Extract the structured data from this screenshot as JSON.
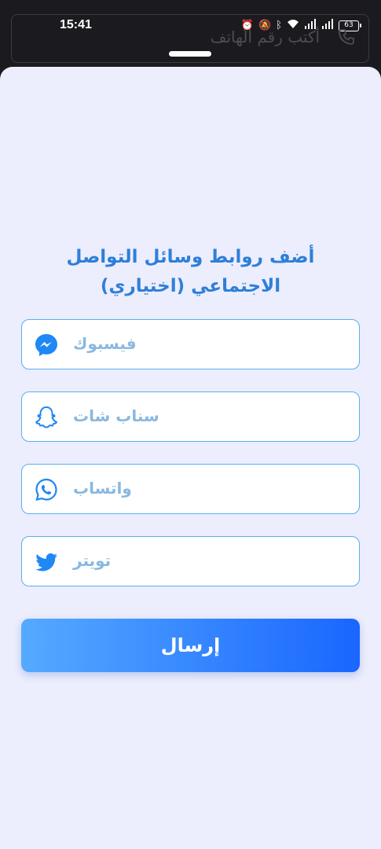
{
  "status_bar": {
    "time": "15:41",
    "battery": "63",
    "icons": [
      "alarm-icon",
      "mute-icon",
      "bluetooth-icon",
      "wifi-icon",
      "signal-icon",
      "signal-icon",
      "battery-icon"
    ]
  },
  "background_field": {
    "placeholder": "أكتب رقم الهاتف",
    "icon": "phone-icon"
  },
  "sheet": {
    "title_line1": "أضف روابط وسائل التواصل",
    "title_line2": "الاجتماعي (اختياري)",
    "fields": [
      {
        "label": "فيسبوك",
        "icon": "messenger-icon",
        "color": "#1e88f5"
      },
      {
        "label": "سناب شات",
        "icon": "snapchat-icon",
        "color": "#1e88f5"
      },
      {
        "label": "واتساب",
        "icon": "whatsapp-icon",
        "color": "#1e88f5"
      },
      {
        "label": "تويتر",
        "icon": "twitter-icon",
        "color": "#1e88f5"
      }
    ],
    "submit_label": "إرسال"
  },
  "colors": {
    "accent": "#2e7fd8",
    "field_border": "#5ab0ee",
    "gradient_start": "#55aaff",
    "gradient_end": "#1a66ff",
    "sheet_bg": "#ecedfd"
  }
}
